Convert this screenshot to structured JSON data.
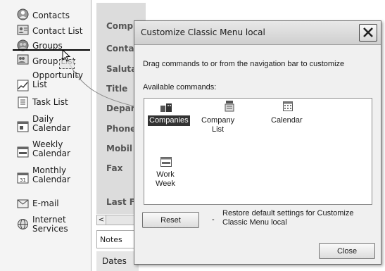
{
  "nav": {
    "items": [
      {
        "label": "Contacts",
        "icon": "person-icon"
      },
      {
        "label": "Contact List",
        "icon": "contact-list-icon"
      },
      {
        "label": "Groups",
        "icon": "group-icon"
      },
      {
        "label": "Group List",
        "icon": "group-list-icon"
      },
      {
        "label": "Opportunity\nList",
        "icon": "opportunity-chart-icon"
      },
      {
        "label": "Task List",
        "icon": "task-list-icon"
      },
      {
        "label": "Daily\nCalendar",
        "icon": "daily-calendar-icon"
      },
      {
        "label": "Weekly\nCalendar",
        "icon": "weekly-calendar-icon"
      },
      {
        "label": "Monthly\nCalendar",
        "icon": "monthly-calendar-icon"
      },
      {
        "label": "E-mail",
        "icon": "email-icon"
      },
      {
        "label": "Internet\nServices",
        "icon": "internet-services-icon"
      }
    ]
  },
  "form": {
    "field_labels": [
      "Comp",
      "Conta",
      "Saluta",
      "Title",
      "Depar",
      "Phone",
      "Mobil",
      "Fax",
      "Last F"
    ],
    "scroll_left": "<",
    "notes_tab": "Notes",
    "dates_label": "Dates"
  },
  "dialog": {
    "title": "Customize Classic Menu local",
    "instruction": "Drag commands to or from the navigation bar to customize",
    "available_label": "Available commands:",
    "commands": [
      {
        "label": "Companies",
        "icon": "companies-icon",
        "selected": true
      },
      {
        "label": "Company List",
        "icon": "company-list-icon",
        "selected": false
      },
      {
        "label": "Calendar",
        "icon": "calendar-icon",
        "selected": false
      },
      {
        "label": "Work\nWeek",
        "icon": "work-week-icon",
        "selected": false
      }
    ],
    "reset_label": "Reset",
    "dash": "-",
    "restore_text": "Restore default settings for Customize Classic Menu local",
    "close_label": "Close"
  }
}
